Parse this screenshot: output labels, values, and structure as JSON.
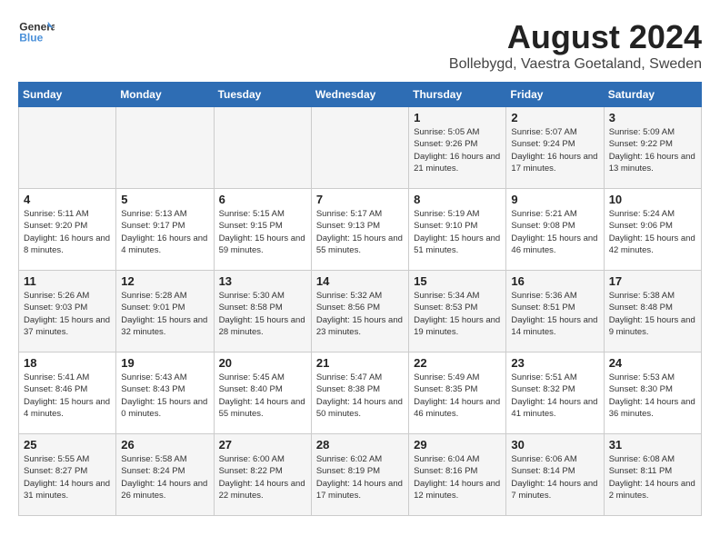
{
  "header": {
    "logo_general": "General",
    "logo_blue": "Blue",
    "month_year": "August 2024",
    "location": "Bollebygd, Vaestra Goetaland, Sweden"
  },
  "calendar": {
    "days_of_week": [
      "Sunday",
      "Monday",
      "Tuesday",
      "Wednesday",
      "Thursday",
      "Friday",
      "Saturday"
    ],
    "weeks": [
      [
        {
          "day": "",
          "info": ""
        },
        {
          "day": "",
          "info": ""
        },
        {
          "day": "",
          "info": ""
        },
        {
          "day": "",
          "info": ""
        },
        {
          "day": "1",
          "info": "Sunrise: 5:05 AM\nSunset: 9:26 PM\nDaylight: 16 hours\nand 21 minutes."
        },
        {
          "day": "2",
          "info": "Sunrise: 5:07 AM\nSunset: 9:24 PM\nDaylight: 16 hours\nand 17 minutes."
        },
        {
          "day": "3",
          "info": "Sunrise: 5:09 AM\nSunset: 9:22 PM\nDaylight: 16 hours\nand 13 minutes."
        }
      ],
      [
        {
          "day": "4",
          "info": "Sunrise: 5:11 AM\nSunset: 9:20 PM\nDaylight: 16 hours\nand 8 minutes."
        },
        {
          "day": "5",
          "info": "Sunrise: 5:13 AM\nSunset: 9:17 PM\nDaylight: 16 hours\nand 4 minutes."
        },
        {
          "day": "6",
          "info": "Sunrise: 5:15 AM\nSunset: 9:15 PM\nDaylight: 15 hours\nand 59 minutes."
        },
        {
          "day": "7",
          "info": "Sunrise: 5:17 AM\nSunset: 9:13 PM\nDaylight: 15 hours\nand 55 minutes."
        },
        {
          "day": "8",
          "info": "Sunrise: 5:19 AM\nSunset: 9:10 PM\nDaylight: 15 hours\nand 51 minutes."
        },
        {
          "day": "9",
          "info": "Sunrise: 5:21 AM\nSunset: 9:08 PM\nDaylight: 15 hours\nand 46 minutes."
        },
        {
          "day": "10",
          "info": "Sunrise: 5:24 AM\nSunset: 9:06 PM\nDaylight: 15 hours\nand 42 minutes."
        }
      ],
      [
        {
          "day": "11",
          "info": "Sunrise: 5:26 AM\nSunset: 9:03 PM\nDaylight: 15 hours\nand 37 minutes."
        },
        {
          "day": "12",
          "info": "Sunrise: 5:28 AM\nSunset: 9:01 PM\nDaylight: 15 hours\nand 32 minutes."
        },
        {
          "day": "13",
          "info": "Sunrise: 5:30 AM\nSunset: 8:58 PM\nDaylight: 15 hours\nand 28 minutes."
        },
        {
          "day": "14",
          "info": "Sunrise: 5:32 AM\nSunset: 8:56 PM\nDaylight: 15 hours\nand 23 minutes."
        },
        {
          "day": "15",
          "info": "Sunrise: 5:34 AM\nSunset: 8:53 PM\nDaylight: 15 hours\nand 19 minutes."
        },
        {
          "day": "16",
          "info": "Sunrise: 5:36 AM\nSunset: 8:51 PM\nDaylight: 15 hours\nand 14 minutes."
        },
        {
          "day": "17",
          "info": "Sunrise: 5:38 AM\nSunset: 8:48 PM\nDaylight: 15 hours\nand 9 minutes."
        }
      ],
      [
        {
          "day": "18",
          "info": "Sunrise: 5:41 AM\nSunset: 8:46 PM\nDaylight: 15 hours\nand 4 minutes."
        },
        {
          "day": "19",
          "info": "Sunrise: 5:43 AM\nSunset: 8:43 PM\nDaylight: 15 hours\nand 0 minutes."
        },
        {
          "day": "20",
          "info": "Sunrise: 5:45 AM\nSunset: 8:40 PM\nDaylight: 14 hours\nand 55 minutes."
        },
        {
          "day": "21",
          "info": "Sunrise: 5:47 AM\nSunset: 8:38 PM\nDaylight: 14 hours\nand 50 minutes."
        },
        {
          "day": "22",
          "info": "Sunrise: 5:49 AM\nSunset: 8:35 PM\nDaylight: 14 hours\nand 46 minutes."
        },
        {
          "day": "23",
          "info": "Sunrise: 5:51 AM\nSunset: 8:32 PM\nDaylight: 14 hours\nand 41 minutes."
        },
        {
          "day": "24",
          "info": "Sunrise: 5:53 AM\nSunset: 8:30 PM\nDaylight: 14 hours\nand 36 minutes."
        }
      ],
      [
        {
          "day": "25",
          "info": "Sunrise: 5:55 AM\nSunset: 8:27 PM\nDaylight: 14 hours\nand 31 minutes."
        },
        {
          "day": "26",
          "info": "Sunrise: 5:58 AM\nSunset: 8:24 PM\nDaylight: 14 hours\nand 26 minutes."
        },
        {
          "day": "27",
          "info": "Sunrise: 6:00 AM\nSunset: 8:22 PM\nDaylight: 14 hours\nand 22 minutes."
        },
        {
          "day": "28",
          "info": "Sunrise: 6:02 AM\nSunset: 8:19 PM\nDaylight: 14 hours\nand 17 minutes."
        },
        {
          "day": "29",
          "info": "Sunrise: 6:04 AM\nSunset: 8:16 PM\nDaylight: 14 hours\nand 12 minutes."
        },
        {
          "day": "30",
          "info": "Sunrise: 6:06 AM\nSunset: 8:14 PM\nDaylight: 14 hours\nand 7 minutes."
        },
        {
          "day": "31",
          "info": "Sunrise: 6:08 AM\nSunset: 8:11 PM\nDaylight: 14 hours\nand 2 minutes."
        }
      ]
    ]
  }
}
